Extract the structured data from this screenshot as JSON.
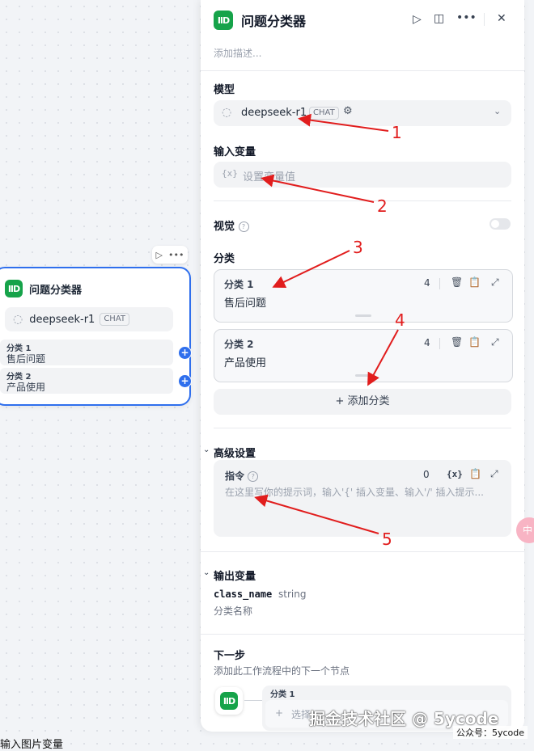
{
  "node": {
    "title": "问题分类器",
    "icon": "classifier-icon",
    "model_name": "deepseek-r1",
    "model_badge": "CHAT",
    "categories": [
      {
        "label": "分类 1",
        "value": "售后问题"
      },
      {
        "label": "分类 2",
        "value": "产品使用"
      }
    ]
  },
  "panel": {
    "title": "问题分类器",
    "description_placeholder": "添加描述...",
    "model_section": "模型",
    "model_name": "deepseek-r1",
    "model_badge": "CHAT",
    "input_var_section": "输入变量",
    "input_var_prefix": "{x}",
    "input_var_placeholder": "设置变量值",
    "vision_label": "视觉",
    "vision_enabled": false,
    "categories_section": "分类",
    "categories": [
      {
        "label": "分类 1",
        "value": "售后问题",
        "count": "4"
      },
      {
        "label": "分类 2",
        "value": "产品使用",
        "count": "4"
      }
    ],
    "add_category": "+ 添加分类",
    "advanced_section": "高级设置",
    "instruction_label": "指令",
    "instruction_count": "0",
    "instruction_var_btn": "{x}",
    "instruction_placeholder": "在这里写你的提示词，输入'{' 插入变量、输入'/' 插入提示...",
    "output_section": "输出变量",
    "output_var_name": "class_name",
    "output_var_type": "string",
    "output_var_desc": "分类名称",
    "next_step_section": "下一步",
    "next_step_desc": "添加此工作流程中的下一个节点",
    "next_step_branch": "分类 1",
    "next_step_select": "选择"
  },
  "annotations": [
    "1",
    "2",
    "3",
    "4",
    "5"
  ],
  "bottom_text": "输入图片变量",
  "watermark": "掘金技术社区 @ 5ycode",
  "watermark_sub": "公众号：5ycode",
  "colors": {
    "accent": "#2f6fed",
    "app_icon": "#16a34a",
    "annotation": "#e11d1d"
  }
}
